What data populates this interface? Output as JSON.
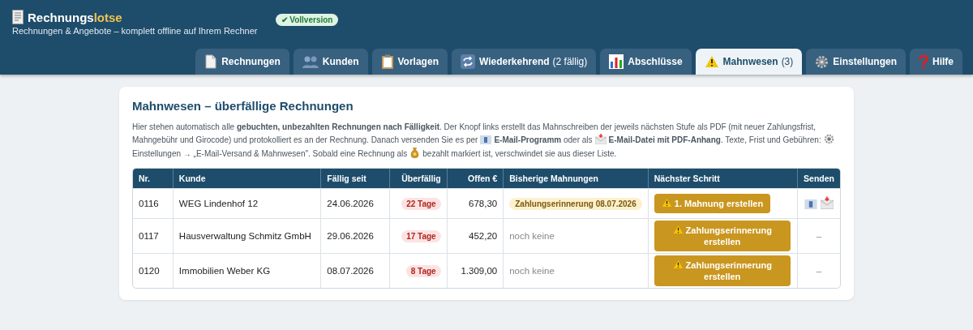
{
  "app": {
    "name_main": "Rechnungs",
    "name_accent": "lotse",
    "subtitle": "Rechnungen & Angebote – komplett offline auf Ihrem Rechner",
    "badge": "✔ Vollversion"
  },
  "tabs": [
    {
      "label": "Rechnungen",
      "selected": false
    },
    {
      "label": "Kunden",
      "selected": false
    },
    {
      "label": "Vorlagen",
      "selected": false
    },
    {
      "label": "Wiederkehrend",
      "count": "(2 fällig)",
      "selected": false
    },
    {
      "label": "Abschlüsse",
      "selected": false
    },
    {
      "label": "Mahnwesen",
      "count": "(3)",
      "selected": true
    },
    {
      "label": "Einstellungen",
      "selected": false
    },
    {
      "label": "Hilfe",
      "selected": false
    }
  ],
  "card": {
    "title": "Mahnwesen – überfällige Rechnungen",
    "description": [
      {
        "kind": "text",
        "text": "Hier stehen automatisch alle **gebuchten, unbezahlten Rechnungen nach Fälligkeit**. Der Knopf links erstellt das Mahnschreiben der jeweils nächsten Stufe als PDF (mit neuer Zahlungsfrist, Mahngebühr und Girocode) und protokolliert es an der Rechnung. Danach versenden Sie es per"
      },
      {
        "kind": "mail"
      },
      {
        "kind": "text",
        "text": "**E-Mail-Programm** oder als"
      },
      {
        "kind": "envelope"
      },
      {
        "kind": "text",
        "text": "**E-Mail-Datei mit PDF-Anhang**. Texte, Frist und Gebühren:"
      },
      {
        "kind": "gear"
      },
      {
        "kind": "text",
        "text": "Einstellungen → „E-Mail-Versand & Mahnwesen\". Sobald eine Rechnung als"
      },
      {
        "kind": "money"
      },
      {
        "kind": "text",
        "text": "bezahlt markiert ist, verschwindet sie aus dieser Liste."
      }
    ]
  },
  "table": {
    "columns": [
      "Nr.",
      "Kunde",
      "Fällig seit",
      "Überfällig",
      "Offen €",
      "Bisherige Mahnungen",
      "Nächster Schritt",
      "Senden"
    ],
    "rows": [
      {
        "nr": "0116",
        "customer": "WEG Lindenhof 12",
        "due": "24.06.2026",
        "overdue": "22 Tage",
        "open": "678,30",
        "history": {
          "kind": "tag",
          "text": "Zahlungserinnerung 08.07.2026"
        },
        "action": "1. Mahnung erstellen",
        "send": {
          "kind": "icons"
        }
      },
      {
        "nr": "0117",
        "customer": "Hausverwaltung Schmitz GmbH",
        "due": "29.06.2026",
        "overdue": "17 Tage",
        "open": "452,20",
        "history": {
          "kind": "none",
          "text": "noch keine"
        },
        "action": "Zahlungserinnerung erstellen",
        "send": {
          "kind": "text",
          "text": "–"
        }
      },
      {
        "nr": "0120",
        "customer": "Immobilien Weber KG",
        "due": "08.07.2026",
        "overdue": "8 Tage",
        "open": "1.309,00",
        "history": {
          "kind": "none",
          "text": "noch keine"
        },
        "action": "Zahlungserinnerung erstellen",
        "send": {
          "kind": "text",
          "text": "–"
        }
      }
    ]
  }
}
